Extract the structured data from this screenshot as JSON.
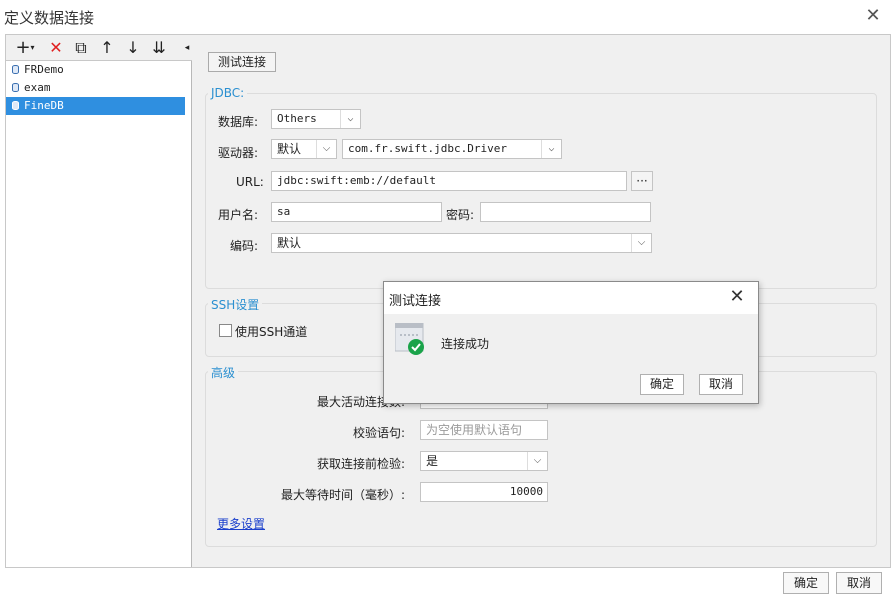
{
  "window": {
    "title": "定义数据连接",
    "close_glyph": "✕"
  },
  "toolbar": {
    "add": "+",
    "add_caret": "▾",
    "delete": "✕",
    "copy": "⧉",
    "up": "↑",
    "down": "↓",
    "sort": "⇊",
    "collapse": "◂"
  },
  "connections": [
    {
      "label": "FRDemo"
    },
    {
      "label": "exam"
    },
    {
      "label": "FineDB"
    }
  ],
  "test_button": "测试连接",
  "jdbc": {
    "group_title": "JDBC:",
    "database_label": "数据库:",
    "database_value": "Others",
    "driver_label": "驱动器:",
    "driver_mode": "默认",
    "driver_class": "com.fr.swift.jdbc.Driver",
    "url_label": "URL:",
    "url_value": "jdbc:swift:emb://default",
    "url_browse": "···",
    "username_label": "用户名:",
    "username_value": "sa",
    "password_label": "密码:",
    "password_value": "",
    "encoding_label": "编码:",
    "encoding_value": "默认"
  },
  "ssh": {
    "group_title": "SSH设置",
    "use_tunnel_label": "使用SSH通道",
    "use_tunnel_checked": false
  },
  "advanced": {
    "group_title": "高级",
    "max_active_label": "最大活动连接数:",
    "validation_label": "校验语句:",
    "validation_placeholder": "为空使用默认语句",
    "test_before_label": "获取连接前检验:",
    "test_before_value": "是",
    "max_wait_label": "最大等待时间（毫秒）:",
    "max_wait_value": "10000",
    "more_settings": "更多设置"
  },
  "footer": {
    "ok": "确定",
    "cancel": "取消"
  },
  "dialog": {
    "title": "测试连接",
    "close_glyph": "✕",
    "message": "连接成功",
    "ok": "确定",
    "cancel": "取消",
    "icon": "connection-success-icon"
  },
  "colors": {
    "accent": "#2a8fd0",
    "selection": "#2f8fe0",
    "success": "#1aa34a",
    "delete": "#e02020",
    "link": "#1a3fcc"
  }
}
